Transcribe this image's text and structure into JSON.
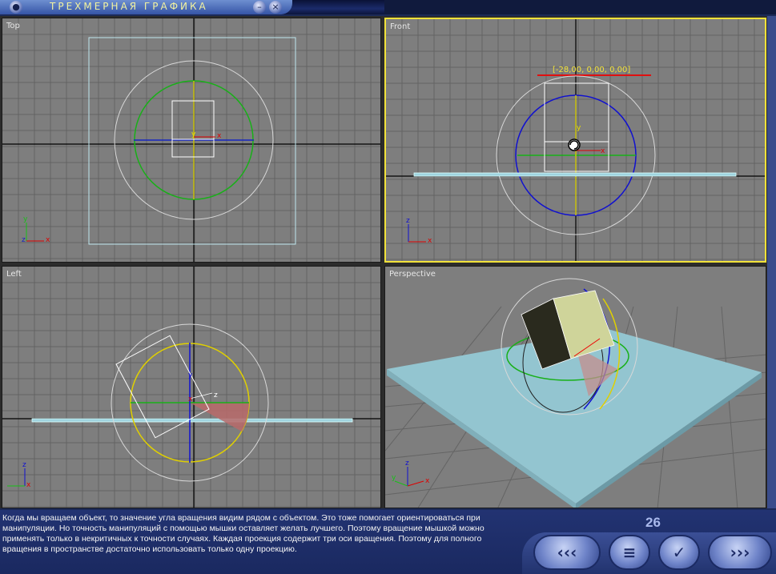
{
  "app": {
    "title": "ТРЕХМЕРНАЯ ГРАФИКА"
  },
  "window_controls": {
    "minimize": "–",
    "close": "×"
  },
  "viewports": {
    "top": {
      "label": "Top"
    },
    "front": {
      "label": "Front",
      "rotation_readout": "[-28,00, 0,00, 0,00]"
    },
    "left": {
      "label": "Left"
    },
    "perspective": {
      "label": "Perspective"
    }
  },
  "axes": {
    "x": "x",
    "y": "y",
    "z": "z"
  },
  "info": {
    "text": "Когда мы вращаем объект, то значение угла вращения видим рядом с объектом. Это тоже помогает ориентироваться при манипуляции. Но точность манипуляций с помощью мышки оставляет желать лучшего. Поэтому вращение мышкой можно применять только в некритичных к точности случаях. Каждая проекция содержит три оси вращения. Поэтому для полного вращения в пространстве достаточно использовать только одну проекцию.",
    "page_number": "26"
  },
  "nav": {
    "back": "‹‹‹",
    "menu": "≡",
    "check": "✓",
    "forward": "›››"
  },
  "colors": {
    "viewport_bg": "#7e7e7e",
    "grid": "#646464",
    "active_border": "#f2e23a",
    "panel": "#1f2e66"
  }
}
